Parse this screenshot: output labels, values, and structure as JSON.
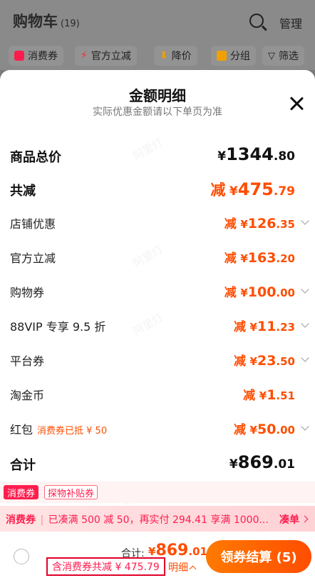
{
  "background": {
    "title": "购物车",
    "count": "(19)",
    "manage": "管理",
    "filters": [
      {
        "label": "消费券",
        "icon": "coupon-icon",
        "color": "#ff1d4e"
      },
      {
        "label": "官方立减",
        "icon": "lightning-icon",
        "color": "#ff2a2a"
      },
      {
        "label": "降价",
        "icon": "down-arrow-icon",
        "color": "#f0a000"
      },
      {
        "label": "分组",
        "icon": "folder-icon",
        "color": "#f0a000"
      },
      {
        "label": "筛选",
        "icon": "filter-icon",
        "color": "#333333"
      }
    ]
  },
  "sheet": {
    "title": "金额明细",
    "subtitle": "实际优惠金额请以下单页为准",
    "goods_total": {
      "label": "商品总价",
      "currency": "¥",
      "int": "1344",
      "dec": ".80"
    },
    "total_cut": {
      "label": "共减",
      "prefix": "减",
      "currency": "¥",
      "int": "475",
      "dec": ".79"
    },
    "items": [
      {
        "label": "店铺优惠",
        "prefix": "减",
        "currency": "¥",
        "int": "126",
        "dec": ".35",
        "expandable": true
      },
      {
        "label": "官方立减",
        "prefix": "减",
        "currency": "¥",
        "int": "163",
        "dec": ".20",
        "expandable": false
      },
      {
        "label": "购物券",
        "prefix": "减",
        "currency": "¥",
        "int": "100",
        "dec": ".00",
        "expandable": true
      },
      {
        "label": "88VIP 专享 9.5 折",
        "prefix": "减",
        "currency": "¥",
        "int": "11",
        "dec": ".23",
        "expandable": true
      },
      {
        "label": "平台券",
        "prefix": "减",
        "currency": "¥",
        "int": "23",
        "dec": ".50",
        "expandable": true
      },
      {
        "label": "淘金币",
        "prefix": "减",
        "currency": "¥",
        "int": "1",
        "dec": ".51",
        "expandable": false
      },
      {
        "label": "红包",
        "note": "消费券已抵 ¥ 50",
        "prefix": "减",
        "currency": "¥",
        "int": "50",
        "dec": ".00",
        "expandable": true
      }
    ],
    "sum": {
      "label": "合计",
      "currency": "¥",
      "int": "869",
      "dec": ".01"
    },
    "watermark": "阿里灯"
  },
  "tags": {
    "primary": "消费券",
    "secondary": "探物补贴券"
  },
  "promo": {
    "tag": "消费券",
    "text": "已凑满 500 减 50，再实付 294.41 享满 1000...",
    "link": "凑单"
  },
  "footer": {
    "total_label": "合计:",
    "total_currency": "¥",
    "total_int": "869",
    "total_dec": ".01",
    "coupon_note": "含消费券共减 ¥ 475.79",
    "detail_link": "明细",
    "checkout": "领券结算 (5)"
  },
  "colors": {
    "accent": "#ff4d00",
    "coupon_red": "#ff1d4e",
    "highlight_box": "#e0002a"
  }
}
